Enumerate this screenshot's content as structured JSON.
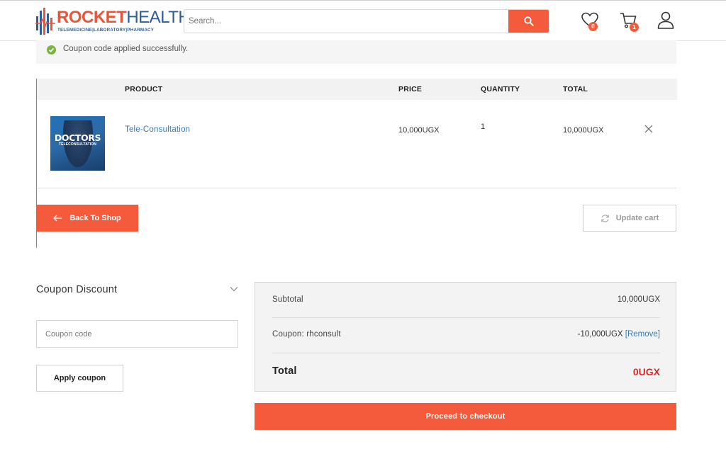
{
  "brand": {
    "name_part1": "ROCKET",
    "name_part2": "HEALTH",
    "tagline": "TELEMEDICINE|LABORATORY|PHARMACY",
    "colors": {
      "accent": "#f45b3c",
      "brand_blue": "#2c5e9e",
      "link": "#3a78b5",
      "total_red": "#e02626",
      "success": "#7cb342"
    }
  },
  "header": {
    "search": {
      "placeholder": "Search...",
      "icon": "search-icon"
    },
    "wishlist": {
      "icon": "heart-icon",
      "count": "0"
    },
    "cart": {
      "icon": "cart-icon",
      "count": "1"
    },
    "account": {
      "icon": "user-icon"
    }
  },
  "notice": {
    "icon": "check-circle-icon",
    "text": "Coupon code applied successfully."
  },
  "cart_table": {
    "columns": [
      "PRODUCT",
      "PRICE",
      "QUANTITY",
      "TOTAL"
    ],
    "items": [
      {
        "thumbnail_title": "DOCTORS",
        "thumbnail_subtitle": "TELECONSULTATION",
        "name": "Tele-Consultation",
        "price": "10,000UGX",
        "quantity": "1",
        "total": "10,000UGX",
        "remove_icon": "close-icon"
      }
    ]
  },
  "actions": {
    "back_to_shop": "Back To Shop",
    "update_cart": "Update cart"
  },
  "coupon": {
    "title": "Coupon Discount",
    "placeholder": "Coupon code",
    "apply_label": "Apply coupon"
  },
  "totals": {
    "subtotal_label": "Subtotal",
    "subtotal_value": "10,000UGX",
    "coupon_label": "Coupon: rhconsult",
    "coupon_value": "-10,000UGX",
    "coupon_remove": "[Remove]",
    "total_label": "Total",
    "total_value": "0UGX"
  },
  "checkout": {
    "label": "Proceed to checkout"
  }
}
